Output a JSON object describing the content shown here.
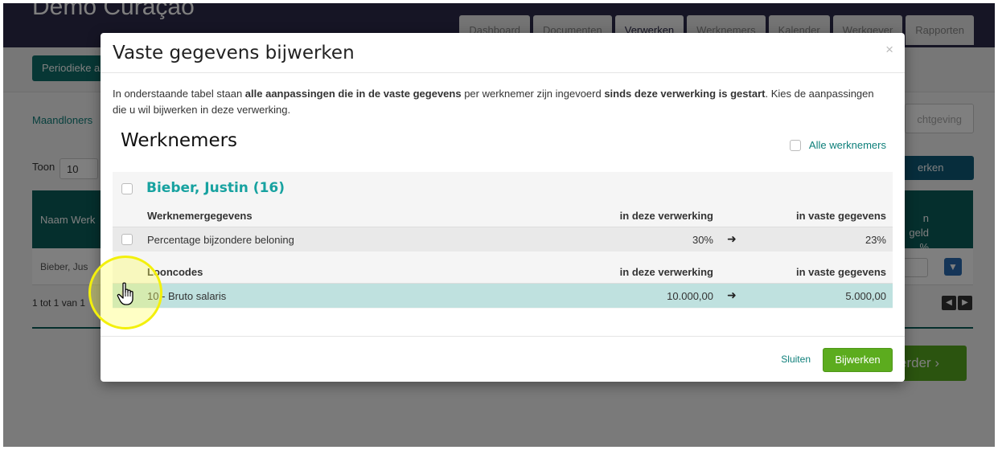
{
  "app": {
    "title": "Demo Curaçao",
    "nav": [
      "Dashboard",
      "Documenten",
      "Verwerken",
      "Werknemers",
      "Kalender",
      "Werkgever",
      "Rapporten"
    ],
    "nav_active_index": 2,
    "period_button": "Periodieke a",
    "tab_label": "Maandloners",
    "notification_button": "chtgeving",
    "toon_label": "Toon",
    "toon_value": "10",
    "bulk_button": "erken",
    "table": {
      "col_name": "Naam Werk",
      "col_right_line1": "n",
      "col_right_line2": "geld",
      "col_right_line3": "%",
      "row_name": "Bieber, Jus"
    },
    "pager_text": "1 tot 1 van 1",
    "next_button": "erder"
  },
  "modal": {
    "title": "Vaste gegevens bijwerken",
    "close_icon": "×",
    "intro": {
      "p1": "In onderstaande tabel staan ",
      "b1": "alle aanpassingen die in de vaste gegevens",
      "p2": " per werknemer zijn ingevoerd ",
      "b2": "sinds deze verwerking is gestart",
      "p3": ". Kies de aanpassingen die u wil bijwerken in deze verwerking."
    },
    "section_title": "Werknemers",
    "all_workers_label": "Alle werknemers",
    "employee": {
      "name": "Bieber, Justin (16)",
      "sections": [
        {
          "title": "Werknemergegevens",
          "col_mid": "in deze verwerking",
          "col_right": "in vaste gegevens",
          "rows": [
            {
              "label": "Percentage bijzondere beloning",
              "current": "30%",
              "fixed": "23%"
            }
          ]
        },
        {
          "title": "Looncodes",
          "col_mid": "in deze verwerking",
          "col_right": "in vaste gegevens",
          "rows": [
            {
              "label": "10 - Bruto salaris",
              "current": "10.000,00",
              "fixed": "5.000,00"
            }
          ]
        }
      ]
    },
    "arrow_glyph": "➜",
    "footer": {
      "close_label": "Sluiten",
      "update_label": "Bijwerken"
    }
  },
  "colors": {
    "accent_teal": "#17a2a0",
    "selected_row": "#bfe1df",
    "update_green": "#5cac1e",
    "cursor_highlight": "#f3f00c"
  }
}
